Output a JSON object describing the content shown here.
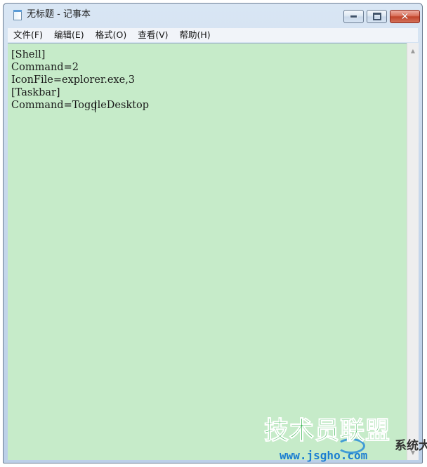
{
  "window": {
    "title": "无标题 - 记事本",
    "close_glyph": "✕"
  },
  "menu": {
    "items": [
      {
        "label": "文件(F)"
      },
      {
        "label": "编辑(E)"
      },
      {
        "label": "格式(O)"
      },
      {
        "label": "查看(V)"
      },
      {
        "label": "帮助(H)"
      }
    ]
  },
  "editor": {
    "background_color": "#c6ebc9",
    "lines": [
      "[Shell]",
      "Command=2",
      "IconFile=explorer.exe,3",
      "[Taskbar]",
      "Command=ToggleDesktop"
    ]
  },
  "scrollbar": {
    "up_icon": "▲",
    "down_icon": "▼"
  },
  "watermark": {
    "main_text": "技术员联盟",
    "side_text": "系统大全",
    "url": "www.jsgho.com",
    "color": "#2fb14a"
  }
}
